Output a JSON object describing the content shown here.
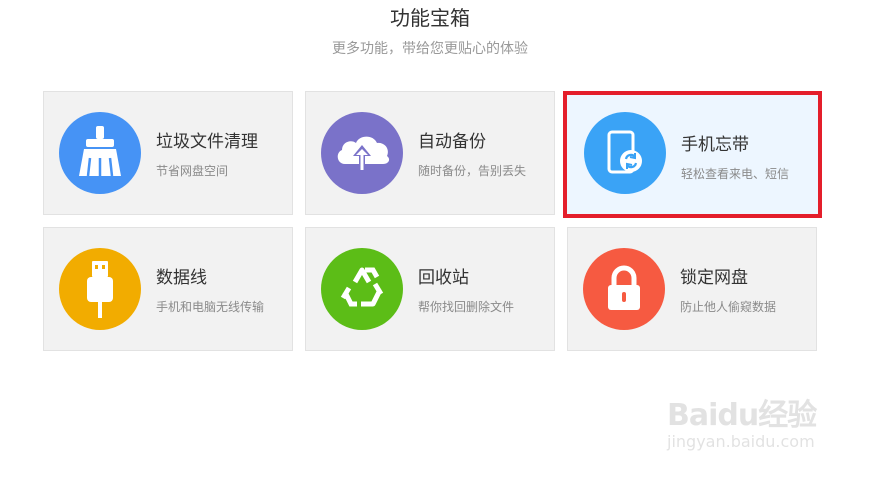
{
  "header": {
    "title": "功能宝箱",
    "subtitle": "更多功能，带给您更贴心的体验"
  },
  "cards": [
    {
      "title": "垃圾文件清理",
      "desc": "节省网盘空间",
      "icon": "broom-icon",
      "color": "#4693f5"
    },
    {
      "title": "自动备份",
      "desc": "随时备份，告别丢失",
      "icon": "cloud-upload-icon",
      "color": "#7a72c9"
    },
    {
      "title": "手机忘带",
      "desc": "轻松查看来电、短信",
      "icon": "phone-sync-icon",
      "color": "#3aa3f6"
    },
    {
      "title": "数据线",
      "desc": "手机和电脑无线传输",
      "icon": "usb-cable-icon",
      "color": "#f2ac00"
    },
    {
      "title": "回收站",
      "desc": "帮你找回删除文件",
      "icon": "recycle-icon",
      "color": "#5cbd17"
    },
    {
      "title": "锁定网盘",
      "desc": "防止他人偷窥数据",
      "icon": "lock-icon",
      "color": "#f65a41"
    }
  ],
  "selected_card": "手机忘带",
  "selection_color": "#e41e2b",
  "watermark": {
    "brand": "Baidu经验",
    "domain": "jingyan.baidu.com"
  }
}
